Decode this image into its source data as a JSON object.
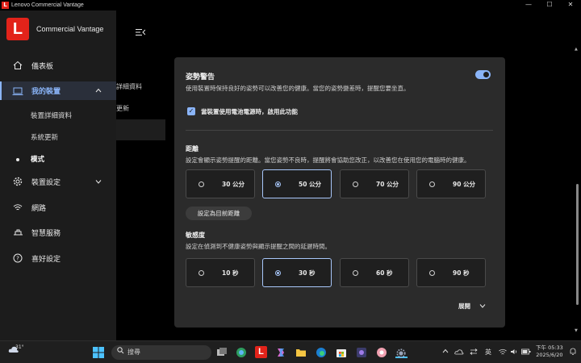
{
  "window": {
    "title": "Lenovo Commercial Vantage",
    "logo_letter": "L",
    "minimize": "—",
    "maximize": "☐",
    "close": "✕"
  },
  "brand": {
    "logo_letter": "L",
    "name": "Commercial Vantage"
  },
  "sidebar": {
    "dashboard": "儀表板",
    "my_device": "我的裝置",
    "device_details": "裝置詳細資料",
    "system_update": "系統更新",
    "mode": "模式",
    "device_settings": "裝置設定",
    "network": "網路",
    "smart_services": "智慧服務",
    "preferences": "喜好設定"
  },
  "background": {
    "label1": "詳細資料",
    "label2": "更新"
  },
  "panel": {
    "title": "姿勢警告",
    "description": "使用裝置時保持良好的姿勢可以改善您的健康。當您的姿勢變差時，提醒您要坐直。",
    "toggle_on": true,
    "checkbox_label": "當裝置使用電池電源時，啟用此功能",
    "checkbox_checked": true,
    "distance": {
      "title": "距離",
      "description": "設定會顯示姿勢提醒的距離。當您姿勢不良時，提醒將會協助您改正，以改善您在使用您的電腦時的健康。",
      "options": [
        "30 公分",
        "50 公分",
        "70 公分",
        "90 公分"
      ],
      "selected": "50 公分",
      "set_button": "設定為目前距離"
    },
    "sensitivity": {
      "title": "敏感度",
      "description": "設定在偵測到不健康姿勢與顯示提醒之間的延遲時間。",
      "options": [
        "10 秒",
        "30 秒",
        "60 秒",
        "90 秒"
      ],
      "selected": "30 秒"
    },
    "expand_label": "展開"
  },
  "taskbar": {
    "weather_temp": "31°",
    "search_placeholder": "搜尋",
    "ime": "英",
    "time": "下午 05:33",
    "date": "2025/6/20"
  }
}
